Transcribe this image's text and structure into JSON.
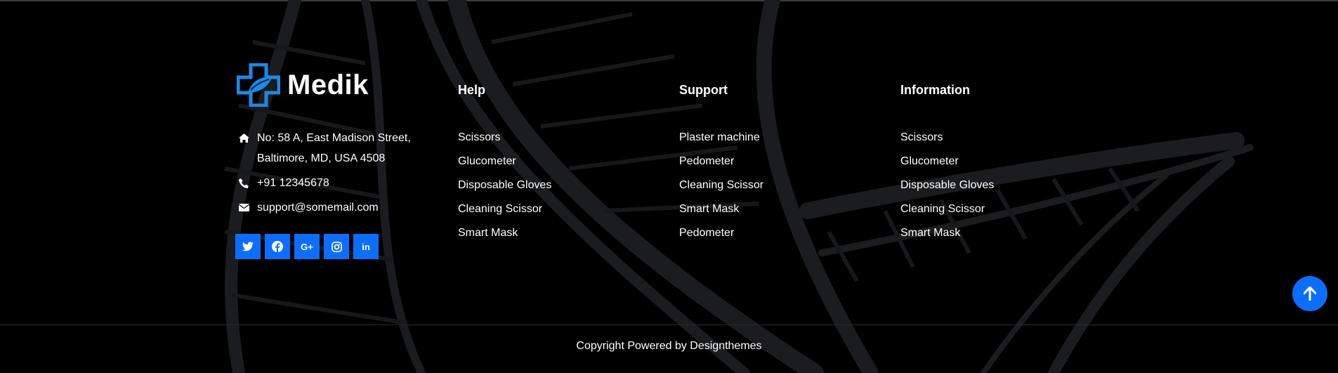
{
  "brand": {
    "name": "Medik",
    "logo_icon": "medical-cross-leaf-icon",
    "accent": "#1e88e5"
  },
  "contact": {
    "address_line1": "No: 58 A, East Madison Street,",
    "address_line2": "Baltimore, MD, USA 4508",
    "phone": "+91 12345678",
    "email": "support@somemail.com"
  },
  "socials": [
    {
      "name": "twitter-icon",
      "glyph": ""
    },
    {
      "name": "facebook-icon",
      "glyph": ""
    },
    {
      "name": "google-plus-icon",
      "glyph": "G+"
    },
    {
      "name": "instagram-icon",
      "glyph": ""
    },
    {
      "name": "linkedin-icon",
      "glyph": "in"
    }
  ],
  "columns": [
    {
      "title": "Help",
      "items": [
        "Scissors",
        "Glucometer",
        "Disposable Gloves",
        "Cleaning Scissor",
        "Smart Mask"
      ]
    },
    {
      "title": "Support",
      "items": [
        "Plaster machine",
        "Pedometer",
        "Cleaning Scissor",
        "Smart Mask",
        "Pedometer"
      ]
    },
    {
      "title": "Information",
      "items": [
        "Scissors",
        "Glucometer",
        "Disposable Gloves",
        "Cleaning Scissor",
        "Smart Mask"
      ]
    }
  ],
  "footer": {
    "copyright": "Copyright Powered by Designthemes"
  },
  "colors": {
    "accent": "#0d6efd",
    "background": "#000000"
  }
}
